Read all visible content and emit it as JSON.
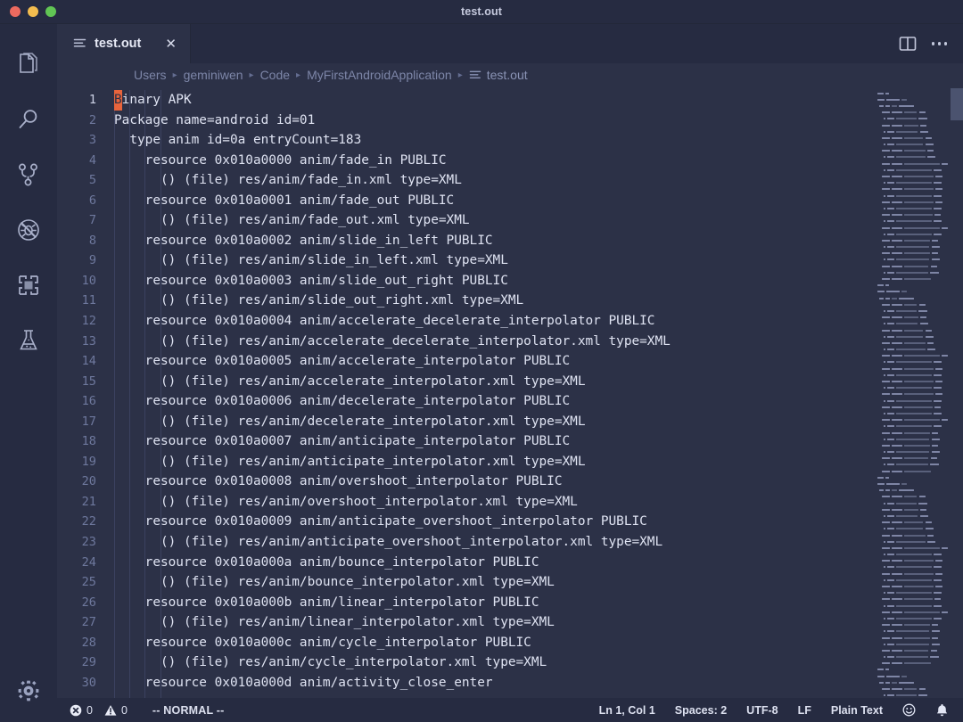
{
  "window": {
    "title": "test.out",
    "controls": [
      "close",
      "minimize",
      "zoom"
    ]
  },
  "activity_bar": {
    "items": [
      {
        "name": "explorer",
        "icon": "files-icon"
      },
      {
        "name": "search",
        "icon": "search-icon"
      },
      {
        "name": "source-control",
        "icon": "source-control-icon"
      },
      {
        "name": "run-and-debug",
        "icon": "debug-disabled-icon"
      },
      {
        "name": "extensions",
        "icon": "extensions-icon"
      },
      {
        "name": "testing",
        "icon": "beaker-icon"
      }
    ],
    "bottom": {
      "name": "manage",
      "icon": "gear-icon"
    }
  },
  "tab_bar": {
    "tabs": [
      {
        "label": "test.out",
        "icon": "text-file-icon",
        "close": "✕",
        "active": true
      }
    ],
    "actions": [
      {
        "name": "split-editor",
        "icon": "split-editor-icon"
      },
      {
        "name": "more-actions",
        "icon": "ellipsis-icon"
      }
    ]
  },
  "breadcrumbs": {
    "separator": "▸",
    "items": [
      "Users",
      "geminiwen",
      "Code",
      "MyFirstAndroidApplication",
      "test.out"
    ]
  },
  "editor": {
    "cursor_char": "B",
    "first_line_rest": "inary APK",
    "lines": [
      {
        "n": 1,
        "text": "Binary APK"
      },
      {
        "n": 2,
        "text": "Package name=android id=01"
      },
      {
        "n": 3,
        "text": "  type anim id=0a entryCount=183"
      },
      {
        "n": 4,
        "text": "    resource 0x010a0000 anim/fade_in PUBLIC"
      },
      {
        "n": 5,
        "text": "      () (file) res/anim/fade_in.xml type=XML"
      },
      {
        "n": 6,
        "text": "    resource 0x010a0001 anim/fade_out PUBLIC"
      },
      {
        "n": 7,
        "text": "      () (file) res/anim/fade_out.xml type=XML"
      },
      {
        "n": 8,
        "text": "    resource 0x010a0002 anim/slide_in_left PUBLIC"
      },
      {
        "n": 9,
        "text": "      () (file) res/anim/slide_in_left.xml type=XML"
      },
      {
        "n": 10,
        "text": "    resource 0x010a0003 anim/slide_out_right PUBLIC"
      },
      {
        "n": 11,
        "text": "      () (file) res/anim/slide_out_right.xml type=XML"
      },
      {
        "n": 12,
        "text": "    resource 0x010a0004 anim/accelerate_decelerate_interpolator PUBLIC"
      },
      {
        "n": 13,
        "text": "      () (file) res/anim/accelerate_decelerate_interpolator.xml type=XML"
      },
      {
        "n": 14,
        "text": "    resource 0x010a0005 anim/accelerate_interpolator PUBLIC"
      },
      {
        "n": 15,
        "text": "      () (file) res/anim/accelerate_interpolator.xml type=XML"
      },
      {
        "n": 16,
        "text": "    resource 0x010a0006 anim/decelerate_interpolator PUBLIC"
      },
      {
        "n": 17,
        "text": "      () (file) res/anim/decelerate_interpolator.xml type=XML"
      },
      {
        "n": 18,
        "text": "    resource 0x010a0007 anim/anticipate_interpolator PUBLIC"
      },
      {
        "n": 19,
        "text": "      () (file) res/anim/anticipate_interpolator.xml type=XML"
      },
      {
        "n": 20,
        "text": "    resource 0x010a0008 anim/overshoot_interpolator PUBLIC"
      },
      {
        "n": 21,
        "text": "      () (file) res/anim/overshoot_interpolator.xml type=XML"
      },
      {
        "n": 22,
        "text": "    resource 0x010a0009 anim/anticipate_overshoot_interpolator PUBLIC"
      },
      {
        "n": 23,
        "text": "      () (file) res/anim/anticipate_overshoot_interpolator.xml type=XML"
      },
      {
        "n": 24,
        "text": "    resource 0x010a000a anim/bounce_interpolator PUBLIC"
      },
      {
        "n": 25,
        "text": "      () (file) res/anim/bounce_interpolator.xml type=XML"
      },
      {
        "n": 26,
        "text": "    resource 0x010a000b anim/linear_interpolator PUBLIC"
      },
      {
        "n": 27,
        "text": "      () (file) res/anim/linear_interpolator.xml type=XML"
      },
      {
        "n": 28,
        "text": "    resource 0x010a000c anim/cycle_interpolator PUBLIC"
      },
      {
        "n": 29,
        "text": "      () (file) res/anim/cycle_interpolator.xml type=XML"
      },
      {
        "n": 30,
        "text": "    resource 0x010a000d anim/activity_close_enter"
      }
    ]
  },
  "status_bar": {
    "errors_icon": "error-circle-icon",
    "errors_count": "0",
    "warnings_icon": "warning-triangle-icon",
    "warnings_count": "0",
    "mode": "-- NORMAL --",
    "position": "Ln 1, Col 1",
    "indentation": "Spaces: 2",
    "encoding": "UTF-8",
    "eol": "LF",
    "language": "Plain Text",
    "smiley_icon": "smiley-icon",
    "bell_icon": "bell-icon"
  },
  "colors": {
    "background": "#2c3147",
    "chrome": "#262b41",
    "cursor": "#e8643c",
    "text": "#dfe3f2",
    "muted": "#7d86a8",
    "line_number": "#6e789d"
  }
}
